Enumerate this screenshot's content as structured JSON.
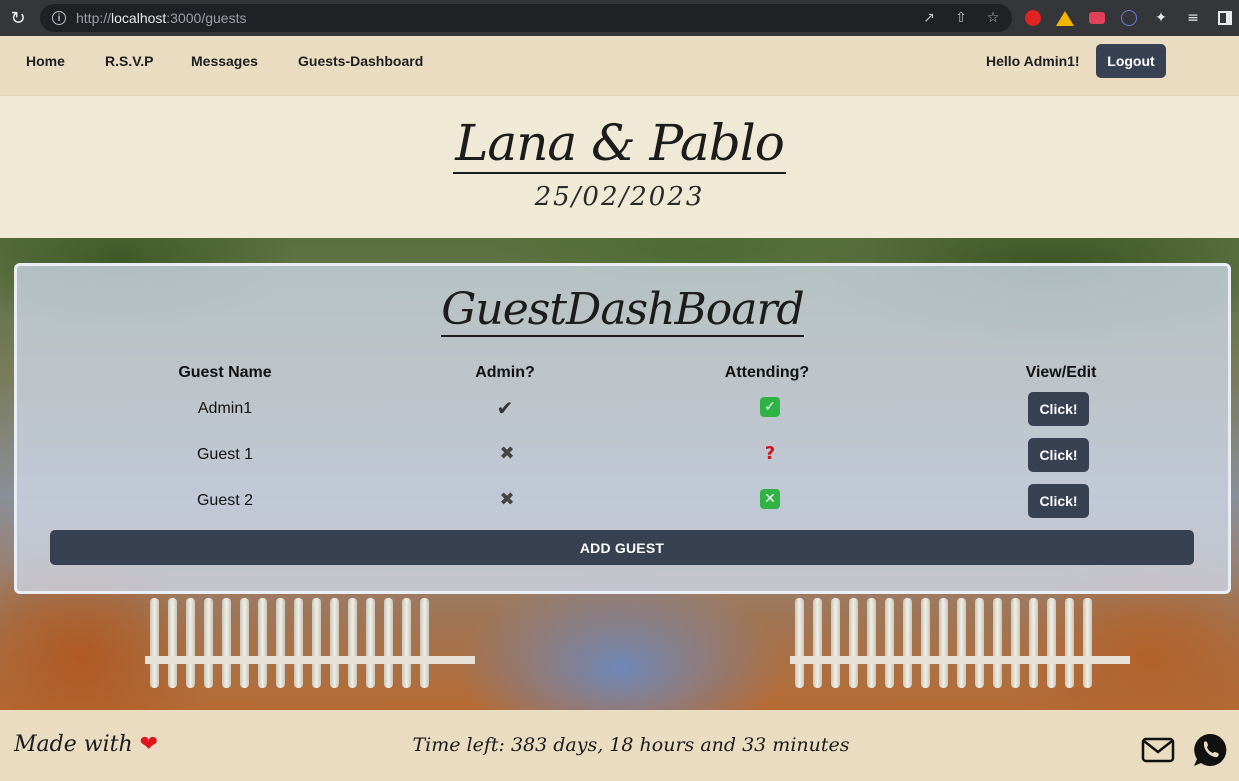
{
  "browser": {
    "url_prefix": "http://",
    "url_host": "localhost",
    "url_path": ":3000/guests",
    "icons": [
      "reload-icon",
      "info-icon",
      "open-external-icon",
      "share-icon",
      "star-icon",
      "extensions-icon",
      "media-icon",
      "side-panel-icon"
    ]
  },
  "nav": {
    "links": [
      "Home",
      "R.S.V.P",
      "Messages",
      "Guests-Dashboard"
    ],
    "greeting": "Hello Admin1!",
    "logout_label": "Logout"
  },
  "header": {
    "couple": "Lana & Pablo",
    "date": "25/02/2023"
  },
  "dashboard": {
    "title": "GuestDashBoard",
    "columns": [
      "Guest Name",
      "Admin?",
      "Attending?",
      "View/Edit"
    ],
    "rows": [
      {
        "name": "Admin1",
        "admin": "yes",
        "attending": "yes",
        "action": "Click!"
      },
      {
        "name": "Guest 1",
        "admin": "no",
        "attending": "unknown",
        "action": "Click!"
      },
      {
        "name": "Guest 2",
        "admin": "no",
        "attending": "no",
        "action": "Click!"
      }
    ],
    "add_label": "ADD GUEST"
  },
  "footer": {
    "made_with": "Made with",
    "time_left": "Time left: 383 days, 18 hours and 33 minutes"
  },
  "colors": {
    "nav_bg": "#e9dcc0",
    "button": "#374151",
    "header_bg": "#efe9d6",
    "check_green": "#2fb344",
    "question_red": "#d0161c"
  }
}
